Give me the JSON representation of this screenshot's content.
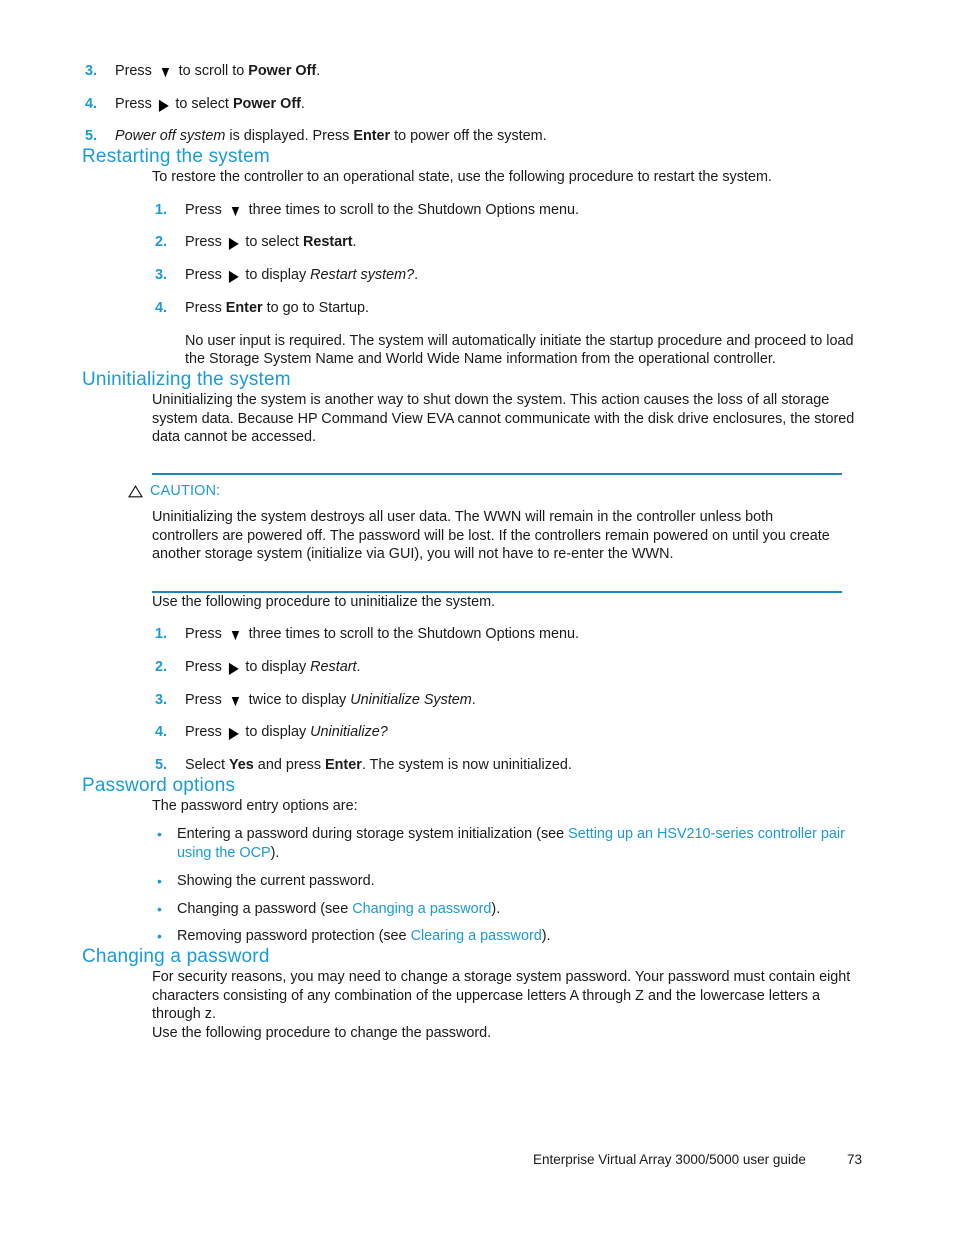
{
  "document": {
    "footer_title": "Enterprise Virtual Array 3000/5000 user guide",
    "page_number": "73"
  },
  "colors": {
    "heading_blue": "#1b9ad8",
    "link_blue": "#1b9ad8",
    "rule_blue": "#1b85c0",
    "body_text": "#1a1a1a"
  },
  "icons": {
    "arrow_down": "▼",
    "arrow_right": "▶",
    "bullet": "•",
    "caution_triangle": "△"
  },
  "poweroff_steps": [
    {
      "num": "3.",
      "parts": [
        {
          "t": "Press ",
          "style": "normal"
        },
        {
          "t": "▼",
          "style": "arrow-down"
        },
        {
          "t": " to scroll to ",
          "style": "normal"
        },
        {
          "t": "Power Off",
          "style": "bold"
        },
        {
          "t": ".",
          "style": "normal"
        }
      ]
    },
    {
      "num": "4.",
      "parts": [
        {
          "t": "Press ",
          "style": "normal"
        },
        {
          "t": "▶",
          "style": "arrow-right"
        },
        {
          "t": " to select ",
          "style": "normal"
        },
        {
          "t": "Power Off",
          "style": "bold"
        },
        {
          "t": ".",
          "style": "normal"
        }
      ]
    },
    {
      "num": "5.",
      "parts": [
        {
          "t": "Power off system",
          "style": "italic"
        },
        {
          "t": " is displayed.  Press ",
          "style": "normal"
        },
        {
          "t": "Enter",
          "style": "bold"
        },
        {
          "t": " to power off the system.",
          "style": "normal"
        }
      ]
    }
  ],
  "restarting": {
    "heading": "Restarting the system",
    "intro": "To restore the controller to an operational state, use the following procedure to restart the system.",
    "steps": [
      {
        "num": "1.",
        "parts": [
          {
            "t": "Press ",
            "style": "normal"
          },
          {
            "t": "▼",
            "style": "arrow-down"
          },
          {
            "t": " three times to scroll to the Shutdown Options menu.",
            "style": "normal"
          }
        ]
      },
      {
        "num": "2.",
        "parts": [
          {
            "t": "Press ",
            "style": "normal"
          },
          {
            "t": "▶",
            "style": "arrow-right"
          },
          {
            "t": " to select ",
            "style": "normal"
          },
          {
            "t": "Restart",
            "style": "bold"
          },
          {
            "t": ".",
            "style": "normal"
          }
        ]
      },
      {
        "num": "3.",
        "parts": [
          {
            "t": "Press ",
            "style": "normal"
          },
          {
            "t": "▶",
            "style": "arrow-right"
          },
          {
            "t": " to display ",
            "style": "normal"
          },
          {
            "t": "Restart system?",
            "style": "italic"
          },
          {
            "t": ".",
            "style": "normal"
          }
        ]
      },
      {
        "num": "4.",
        "parts": [
          {
            "t": "Press ",
            "style": "normal"
          },
          {
            "t": "Enter",
            "style": "bold"
          },
          {
            "t": " to go to Startup.",
            "style": "normal"
          }
        ],
        "sub": "No user input is required.  The system will automatically initiate the startup procedure and proceed to load the Storage System Name and World Wide Name information from the operational controller."
      }
    ]
  },
  "uninitializing": {
    "heading": "Uninitializing the system",
    "intro": "Uninitializing the system is another way to shut down the system.  This action causes the loss of all storage system data.  Because HP Command View EVA cannot communicate with the disk drive enclosures, the stored data cannot be accessed.",
    "caution": {
      "label": "CAUTION:",
      "text": "Uninitializing the system destroys all user data.  The WWN will remain in the controller unless both controllers are powered off.  The password will be lost.  If the controllers remain powered on until you create another storage system (initialize via GUI), you will not have to re-enter the WWN."
    },
    "procedure_intro": "Use the following procedure to uninitialize the system.",
    "steps": [
      {
        "num": "1.",
        "parts": [
          {
            "t": "Press ",
            "style": "normal"
          },
          {
            "t": "▼",
            "style": "arrow-down"
          },
          {
            "t": " three times to scroll to the Shutdown Options menu.",
            "style": "normal"
          }
        ]
      },
      {
        "num": "2.",
        "parts": [
          {
            "t": "Press ",
            "style": "normal"
          },
          {
            "t": "▶",
            "style": "arrow-right"
          },
          {
            "t": " to display ",
            "style": "normal"
          },
          {
            "t": "Restart",
            "style": "italic"
          },
          {
            "t": ".",
            "style": "normal"
          }
        ]
      },
      {
        "num": "3.",
        "parts": [
          {
            "t": "Press ",
            "style": "normal"
          },
          {
            "t": "▼",
            "style": "arrow-down"
          },
          {
            "t": " twice to display ",
            "style": "normal"
          },
          {
            "t": "Uninitialize System",
            "style": "italic"
          },
          {
            "t": ".",
            "style": "normal"
          }
        ]
      },
      {
        "num": "4.",
        "parts": [
          {
            "t": "Press ",
            "style": "normal"
          },
          {
            "t": "▶",
            "style": "arrow-right"
          },
          {
            "t": " to display ",
            "style": "normal"
          },
          {
            "t": "Uninitialize?",
            "style": "italic"
          }
        ]
      },
      {
        "num": "5.",
        "parts": [
          {
            "t": "Select ",
            "style": "normal"
          },
          {
            "t": "Yes",
            "style": "bold"
          },
          {
            "t": " and press ",
            "style": "normal"
          },
          {
            "t": "Enter",
            "style": "bold"
          },
          {
            "t": ".  The system is now uninitialized.",
            "style": "normal"
          }
        ]
      }
    ]
  },
  "password_options": {
    "heading": "Password options",
    "intro": "The password entry options are:",
    "bullets": [
      {
        "parts": [
          {
            "t": "Entering a password during storage system initialization (see ",
            "style": "normal"
          },
          {
            "t": "Setting up an HSV210-series controller pair using the OCP",
            "style": "link"
          },
          {
            "t": ").",
            "style": "normal"
          }
        ]
      },
      {
        "parts": [
          {
            "t": "Showing the current password.",
            "style": "normal"
          }
        ]
      },
      {
        "parts": [
          {
            "t": "Changing a password (see ",
            "style": "normal"
          },
          {
            "t": "Changing a password",
            "style": "link"
          },
          {
            "t": ").",
            "style": "normal"
          }
        ]
      },
      {
        "parts": [
          {
            "t": "Removing password protection (see ",
            "style": "normal"
          },
          {
            "t": "Clearing a password",
            "style": "link"
          },
          {
            "t": ").",
            "style": "normal"
          }
        ]
      }
    ]
  },
  "changing_password": {
    "heading": "Changing a password",
    "para1": "For security reasons, you may need to change a storage system password.  Your password must contain eight characters consisting of any combination of the uppercase letters A through Z and the lowercase letters a through z.",
    "para2": "Use the following procedure to change the password."
  }
}
